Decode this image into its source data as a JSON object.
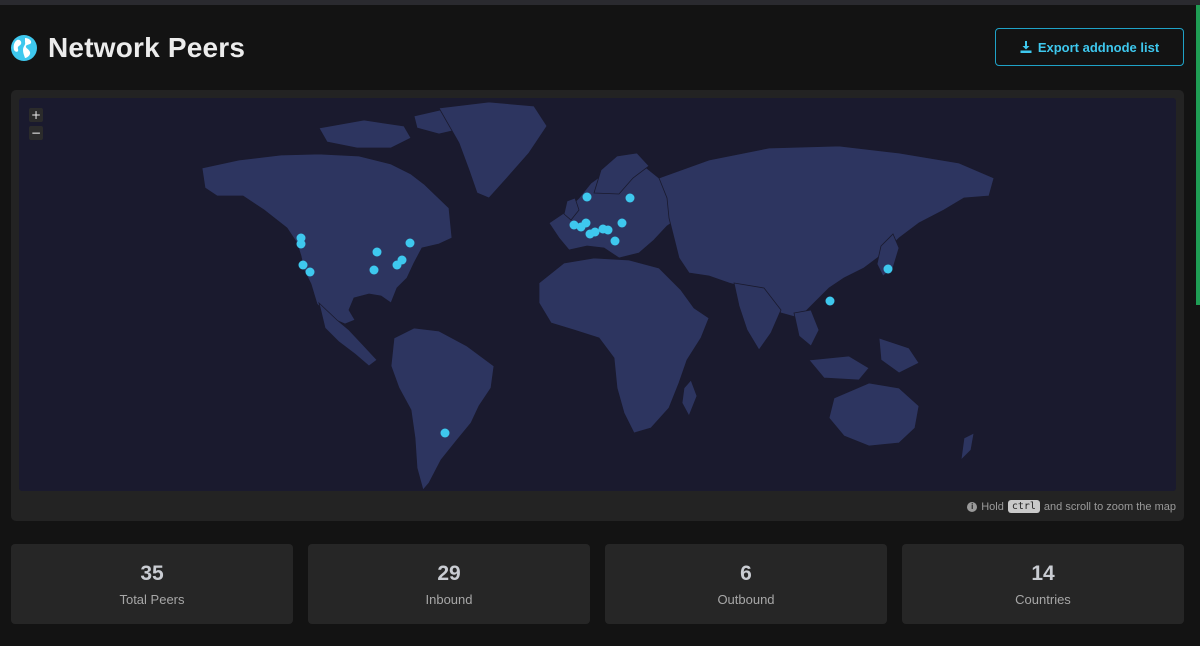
{
  "header": {
    "title": "Network Peers",
    "export_label": "Export addnode list"
  },
  "map": {
    "zoom_in": "+",
    "zoom_out": "−",
    "hint_prefix": "Hold",
    "hint_key": "ctrl",
    "hint_suffix": "and scroll to zoom the map",
    "peer_color": "#3ec8ee",
    "land_color": "#2d3560"
  },
  "stats": [
    {
      "value": "35",
      "label": "Total Peers"
    },
    {
      "value": "29",
      "label": "Inbound"
    },
    {
      "value": "6",
      "label": "Outbound"
    },
    {
      "value": "14",
      "label": "Countries"
    }
  ],
  "colors": {
    "accent": "#3ec8ee",
    "background": "#131313",
    "card": "#232323"
  }
}
